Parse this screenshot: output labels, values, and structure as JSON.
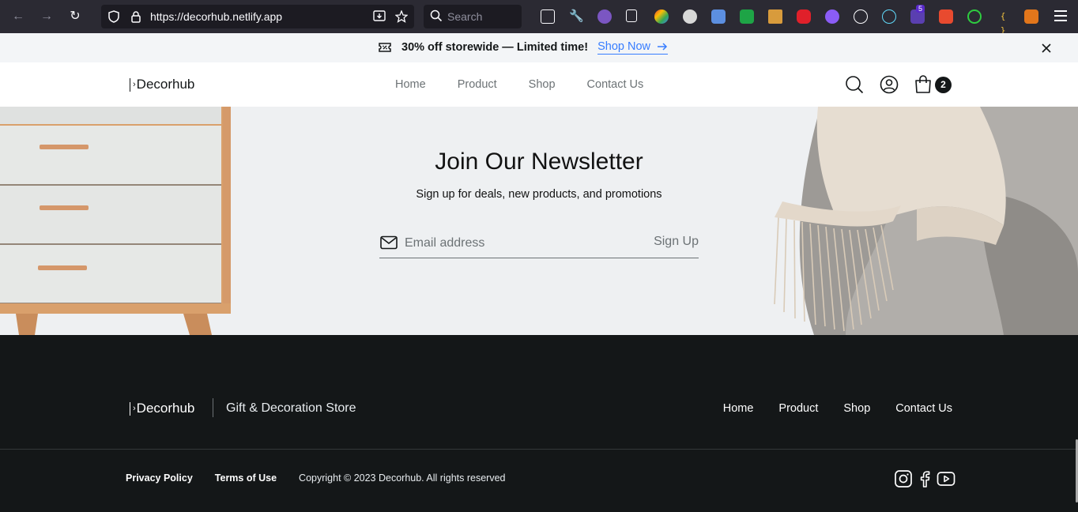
{
  "browser": {
    "url": "https://decorhub.netlify.app",
    "search_placeholder": "Search",
    "extensions_badge": "5"
  },
  "announcement": {
    "text": "30% off storewide — Limited time!",
    "link": "Shop Now"
  },
  "header": {
    "logo": "Decorhub",
    "nav": [
      "Home",
      "Product",
      "Shop",
      "Contact Us"
    ],
    "cart_count": "2"
  },
  "newsletter": {
    "title": "Join Our Newsletter",
    "subtitle": "Sign up for deals, new products, and promotions",
    "email_placeholder": "Email address",
    "button": "Sign Up"
  },
  "footer": {
    "logo": "Decorhub",
    "tagline": "Gift & Decoration Store",
    "nav": [
      "Home",
      "Product",
      "Shop",
      "Contact Us"
    ],
    "privacy": "Privacy Policy",
    "terms": "Terms of Use",
    "copyright": "Copyright © 2023 Decorhub. All rights reserved",
    "social": [
      "instagram-icon",
      "facebook-icon",
      "youtube-icon"
    ]
  },
  "colors": {
    "accent_link": "#377dff",
    "footer_bg": "#141718",
    "newsletter_bg": "#eef0f2",
    "announce_bg": "#f3f5f7"
  }
}
